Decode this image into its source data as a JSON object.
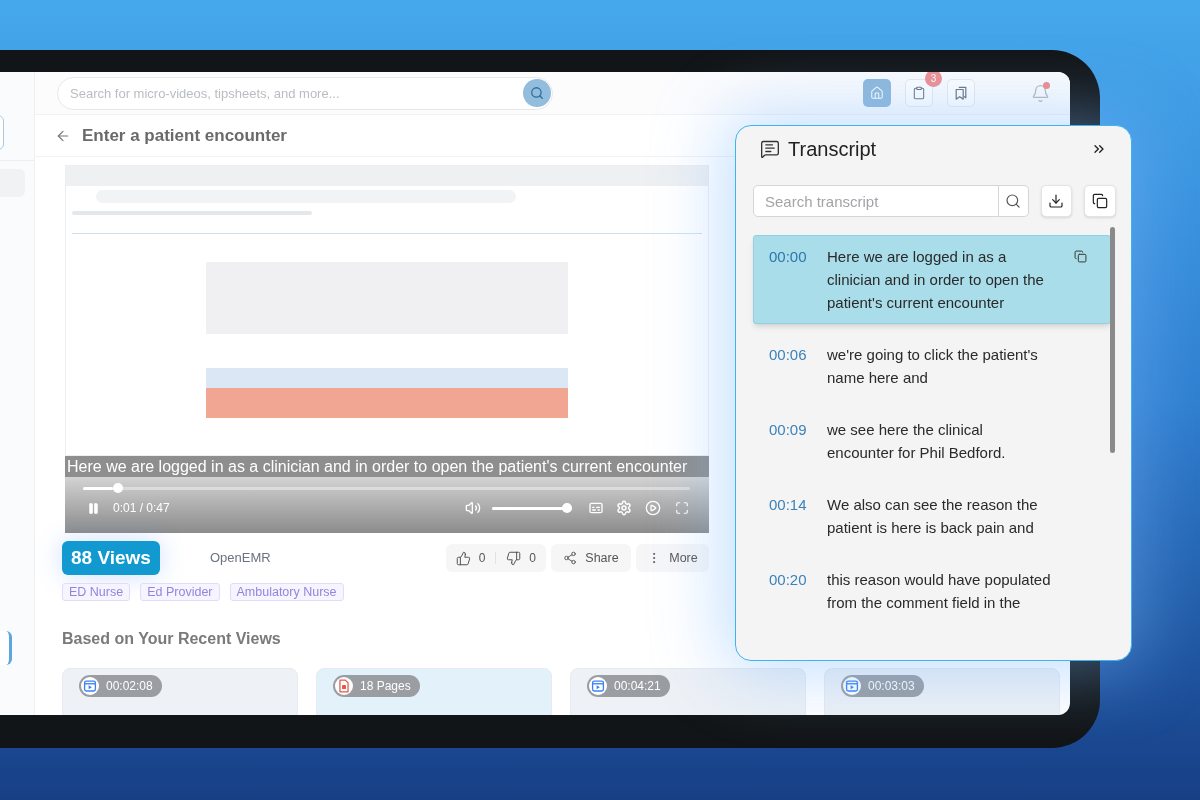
{
  "header": {
    "search": {
      "placeholder": "Search for micro-videos, tipsheets, and more..."
    },
    "nav_buttons": [
      {
        "kind": "home",
        "selected": true
      },
      {
        "kind": "clipboard",
        "selected": false,
        "badge": "3"
      },
      {
        "kind": "bookmarks",
        "selected": false
      }
    ],
    "notifications": {
      "unread": true
    }
  },
  "page": {
    "title": "Enter a patient encounter"
  },
  "video": {
    "caption": "Here we are logged in as a clinician and in order to open the patient's current encounter",
    "playing": true,
    "progress": {
      "level": 0.05
    },
    "time": "0:01 / 0:47",
    "volume": {
      "level": 1
    }
  },
  "details": {
    "views": "88 Views",
    "channel": "OpenEMR",
    "likes": "0",
    "dislikes": "0",
    "actions": [
      {
        "kind": "share",
        "label": "Share"
      },
      {
        "kind": "more",
        "label": "More"
      }
    ],
    "tags": [
      "ED Nurse",
      "Ed Provider",
      "Ambulatory Nurse"
    ]
  },
  "recent": {
    "title": "Based on Your Recent Views",
    "items": [
      {
        "kind": "video",
        "badge": "00:02:08"
      },
      {
        "kind": "document",
        "badge": "18 Pages"
      },
      {
        "kind": "video",
        "badge": "00:04:21"
      },
      {
        "kind": "video",
        "badge": "00:03:03"
      }
    ]
  },
  "transcript": {
    "title": "Transcript",
    "search": {
      "placeholder": "Search transcript"
    },
    "entries": [
      {
        "time": "00:00",
        "text": "Here we are logged in as a clinician and in order to open the patient's current encounter",
        "selected": true
      },
      {
        "time": "00:06",
        "text": "we're going to click the patient's name here and",
        "selected": false
      },
      {
        "time": "00:09",
        "text": "we see here the clinical encounter for Phil Bedford.",
        "selected": false
      },
      {
        "time": "00:14",
        "text": "We also can see the reason the patient is here is back pain and",
        "selected": false
      },
      {
        "time": "00:20",
        "text": "this reason would have populated from the comment field in the",
        "selected": false
      }
    ]
  }
}
